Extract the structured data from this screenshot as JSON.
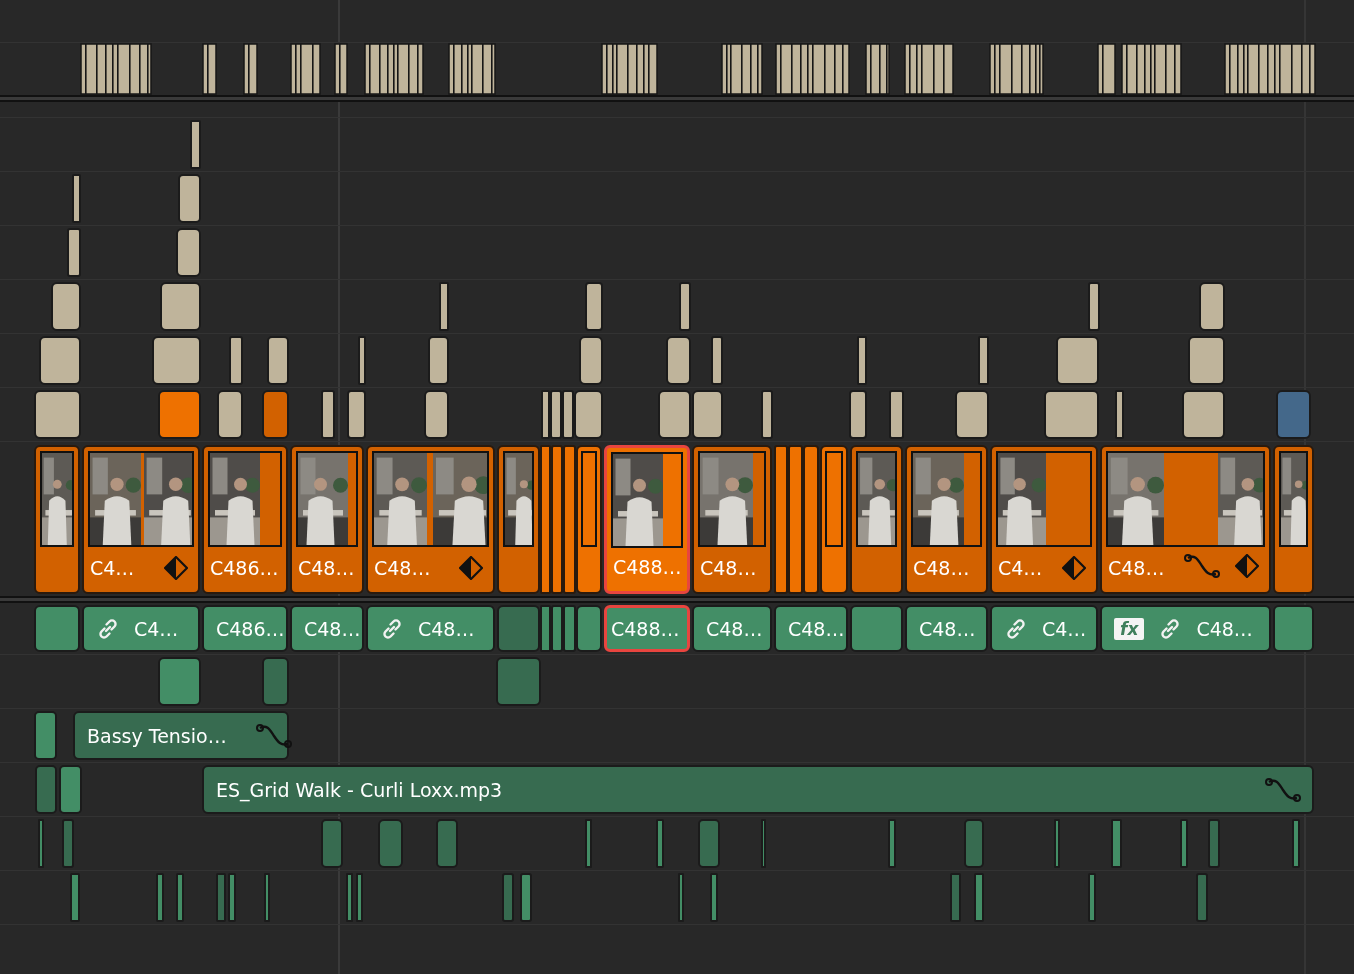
{
  "video_tracks": [
    {
      "clips": [
        {
          "color": "#bfb49b"
        }
      ]
    },
    {
      "clips": [
        {
          "color": "#bfb49b"
        },
        {
          "color": "#bfb49b"
        }
      ]
    },
    {
      "clips": [
        {
          "color": "#bfb49b"
        },
        {
          "color": "#bfb49b"
        }
      ]
    },
    {
      "clips": [
        {
          "color": "#bfb49b"
        },
        {
          "color": "#bfb49b"
        },
        {
          "color": "#bfb49b"
        },
        {
          "color": "#bfb49b"
        },
        {
          "color": "#bfb49b"
        },
        {
          "color": "#bfb49b"
        },
        {
          "color": "#bfb49b"
        }
      ]
    },
    {
      "clips": [
        {
          "color": "#bfb49b"
        },
        {
          "color": "#bfb49b"
        },
        {
          "color": "#bfb49b"
        },
        {
          "color": "#bfb49b"
        },
        {
          "color": "#bfb49b"
        },
        {
          "color": "#bfb49b"
        },
        {
          "color": "#bfb49b"
        },
        {
          "color": "#bfb49b"
        },
        {
          "color": "#bfb49b"
        },
        {
          "color": "#bfb49b"
        },
        {
          "color": "#bfb49b"
        },
        {
          "color": "#bfb49b"
        },
        {
          "color": "#bfb49b"
        }
      ]
    },
    {
      "clips": [
        {
          "color": "#bfb49b"
        },
        {
          "color": "#ee7100"
        },
        {
          "color": "#bfb49b"
        },
        {
          "color": "#d26100"
        },
        {
          "color": "#bfb49b"
        },
        {
          "color": "#bfb49b"
        },
        {
          "color": "#bfb49b"
        },
        {
          "color": "#bfb49b"
        },
        {
          "color": "#bfb49b"
        },
        {
          "color": "#bfb49b"
        },
        {
          "color": "#bfb49b"
        },
        {
          "color": "#bfb49b"
        },
        {
          "color": "#bfb49b"
        },
        {
          "color": "#bfb49b"
        },
        {
          "color": "#bfb49b"
        },
        {
          "color": "#bfb49b"
        },
        {
          "color": "#bfb49b"
        },
        {
          "color": "#bfb49b"
        },
        {
          "color": "#bfb49b"
        },
        {
          "color": "#bfb49b"
        },
        {
          "color": "#44688a"
        }
      ]
    }
  ],
  "main_video_track": {
    "clips": [
      {
        "kind": "thumb",
        "color": "#d26100",
        "selected": false,
        "graded": false,
        "animated": false
      },
      {
        "kind": "thumb",
        "label": "C4…",
        "color": "#d26100",
        "selected": false,
        "graded": true,
        "animated": false
      },
      {
        "kind": "thumb",
        "label": "C486…",
        "color": "#d26100",
        "selected": false,
        "graded": false,
        "animated": false
      },
      {
        "kind": "thumb",
        "label": "C48…",
        "color": "#d26100",
        "selected": false,
        "graded": false,
        "animated": false
      },
      {
        "kind": "thumb",
        "label": "C48…",
        "color": "#d26100",
        "selected": false,
        "graded": true,
        "animated": false
      },
      {
        "kind": "thumb",
        "color": "#d26100",
        "selected": false,
        "graded": false,
        "animated": false
      },
      {
        "kind": "sliver",
        "color": "#ee7100",
        "selected": false,
        "graded": false,
        "animated": false
      },
      {
        "kind": "sliver",
        "color": "#ee7100",
        "selected": false,
        "graded": false,
        "animated": false
      },
      {
        "kind": "sliver",
        "color": "#ee7100",
        "selected": false,
        "graded": false,
        "animated": false
      },
      {
        "kind": "framed",
        "color": "#ee7100",
        "selected": false,
        "graded": false,
        "animated": false
      },
      {
        "kind": "thumb",
        "label": "C488…",
        "color": "#ee7100",
        "selected": true,
        "graded": false,
        "animated": false
      },
      {
        "kind": "thumb",
        "label": "C48…",
        "color": "#d26100",
        "selected": false,
        "graded": false,
        "animated": false
      },
      {
        "kind": "sliver",
        "color": "#ee7100",
        "selected": false,
        "graded": false,
        "animated": false
      },
      {
        "kind": "sliver",
        "color": "#ee7100",
        "selected": false,
        "graded": false,
        "animated": false
      },
      {
        "kind": "sliver",
        "color": "#ee7100",
        "selected": false,
        "graded": false,
        "animated": false
      },
      {
        "kind": "framed",
        "color": "#ee7100",
        "selected": false,
        "graded": false,
        "animated": false
      },
      {
        "kind": "thumb",
        "color": "#d26100",
        "selected": false,
        "graded": false,
        "animated": false
      },
      {
        "kind": "thumb",
        "label": "C48…",
        "color": "#d26100",
        "selected": false,
        "graded": false,
        "animated": false
      },
      {
        "kind": "thumb",
        "label": "C4…",
        "color": "#d26100",
        "selected": false,
        "graded": true,
        "animated": false
      },
      {
        "kind": "thumb",
        "label": "C48…",
        "color": "#d26100",
        "selected": false,
        "graded": true,
        "animated": true
      },
      {
        "kind": "thumb",
        "color": "#d26100",
        "selected": false,
        "graded": false,
        "animated": false
      }
    ]
  },
  "audio_tracks": [
    {
      "clips": [
        {
          "color": "#438e66",
          "selected": false,
          "linked": false
        },
        {
          "label": "C4…",
          "color": "#438e66",
          "selected": false,
          "linked": true
        },
        {
          "label": "C486…",
          "color": "#438e66",
          "selected": false,
          "linked": false
        },
        {
          "label": "C48…",
          "color": "#438e66",
          "selected": false,
          "linked": false
        },
        {
          "label": "C48…",
          "color": "#438e66",
          "selected": false,
          "linked": true
        },
        {
          "color": "#376b50",
          "selected": false,
          "linked": false
        },
        {
          "color": "#438e66",
          "selected": false,
          "linked": false
        },
        {
          "color": "#438e66",
          "selected": false,
          "linked": false
        },
        {
          "color": "#438e66",
          "selected": false,
          "linked": false
        },
        {
          "color": "#438e66",
          "selected": false,
          "linked": false
        },
        {
          "label": "C488…",
          "color": "#438e66",
          "selected": true,
          "linked": false
        },
        {
          "label": "C48…",
          "color": "#438e66",
          "selected": false,
          "linked": false
        },
        {
          "label": "C48…",
          "color": "#438e66",
          "selected": false,
          "linked": false
        },
        {
          "color": "#438e66",
          "selected": false,
          "linked": false
        },
        {
          "label": "C48…",
          "color": "#438e66",
          "selected": false,
          "linked": false
        },
        {
          "label": "C4…",
          "color": "#438e66",
          "selected": false,
          "linked": true
        },
        {
          "label": "C48…",
          "badge": "fx",
          "color": "#438e66",
          "selected": false,
          "linked": true
        },
        {
          "color": "#438e66",
          "selected": false,
          "linked": false
        }
      ]
    },
    {
      "clips": [
        {
          "color": "#438e66"
        },
        {
          "color": "#376b50"
        },
        {
          "color": "#376b50"
        }
      ]
    },
    {
      "clips": [
        {
          "color": "#438e66",
          "animated": false
        },
        {
          "label": "Bassy Tensio…",
          "color": "#376b50",
          "animated": true
        }
      ]
    },
    {
      "clips": [
        {
          "color": "#376b50",
          "animated": false
        },
        {
          "color": "#438e66",
          "animated": false
        },
        {
          "label": "ES_Grid Walk - Curli Loxx.mp3",
          "color": "#376b50",
          "animated": true
        }
      ]
    },
    {
      "clips": [
        {
          "color": "#438e66"
        },
        {
          "color": "#376b50"
        },
        {
          "color": "#376b50"
        },
        {
          "color": "#376b50"
        },
        {
          "color": "#376b50"
        },
        {
          "color": "#438e66"
        },
        {
          "color": "#438e66"
        },
        {
          "color": "#376b50"
        },
        {
          "color": "#438e66"
        },
        {
          "color": "#438e66"
        },
        {
          "color": "#376b50"
        },
        {
          "color": "#438e66"
        },
        {
          "color": "#438e66"
        },
        {
          "color": "#438e66"
        },
        {
          "color": "#376b50"
        },
        {
          "color": "#438e66"
        }
      ]
    },
    {
      "clips": [
        {
          "color": "#438e66"
        },
        {
          "color": "#438e66"
        },
        {
          "color": "#438e66"
        },
        {
          "color": "#376b50"
        },
        {
          "color": "#438e66"
        },
        {
          "color": "#438e66"
        },
        {
          "color": "#438e66"
        },
        {
          "color": "#438e66"
        },
        {
          "color": "#376b50"
        },
        {
          "color": "#438e66"
        },
        {
          "color": "#438e66"
        },
        {
          "color": "#438e66"
        },
        {
          "color": "#376b50"
        },
        {
          "color": "#438e66"
        },
        {
          "color": "#438e66"
        },
        {
          "color": "#376b50"
        }
      ]
    }
  ]
}
